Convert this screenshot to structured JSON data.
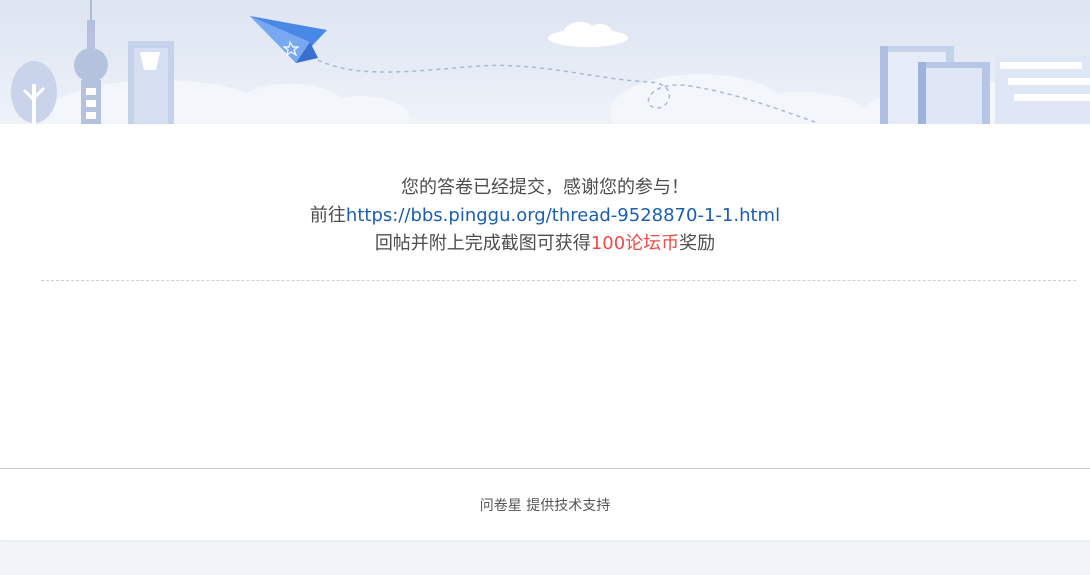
{
  "message": {
    "line1": "您的答卷已经提交，感谢您的参与！",
    "line2_prefix": "前往",
    "line2_link": "https://bbs.pinggu.org/thread-9528870-1-1.html",
    "line3_prefix": "回帖并附上完成截图可获得",
    "line3_reward": "100论坛币",
    "line3_suffix": "奖励"
  },
  "footer": {
    "brand": "问卷星",
    "text": "提供技术支持"
  },
  "colors": {
    "link": "#1b5fae",
    "reward": "#ee4a4a",
    "text": "#4d4d4d",
    "banner_bg": "#e4eaf5",
    "page_bg": "#f1f4f9"
  },
  "icons": {
    "banner": [
      "tree-icon",
      "tv-tower-icon",
      "skyscraper-icon",
      "paper-plane-icon",
      "cloud-icon",
      "books-icon"
    ]
  }
}
